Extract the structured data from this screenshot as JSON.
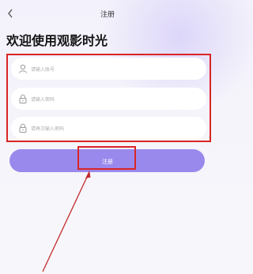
{
  "nav": {
    "title": "注册",
    "back_icon": "chevron-left-icon"
  },
  "headline": "欢迎使用观影时光",
  "form": {
    "fields": [
      {
        "icon": "user-icon",
        "placeholder": "请输入账号"
      },
      {
        "icon": "lock-icon",
        "placeholder": "请输入密码"
      },
      {
        "icon": "lock-icon",
        "placeholder": "请再次输入密码"
      }
    ]
  },
  "submit": {
    "label": "注册",
    "color": "#9a89ec"
  },
  "annotation_color": "#d92525"
}
